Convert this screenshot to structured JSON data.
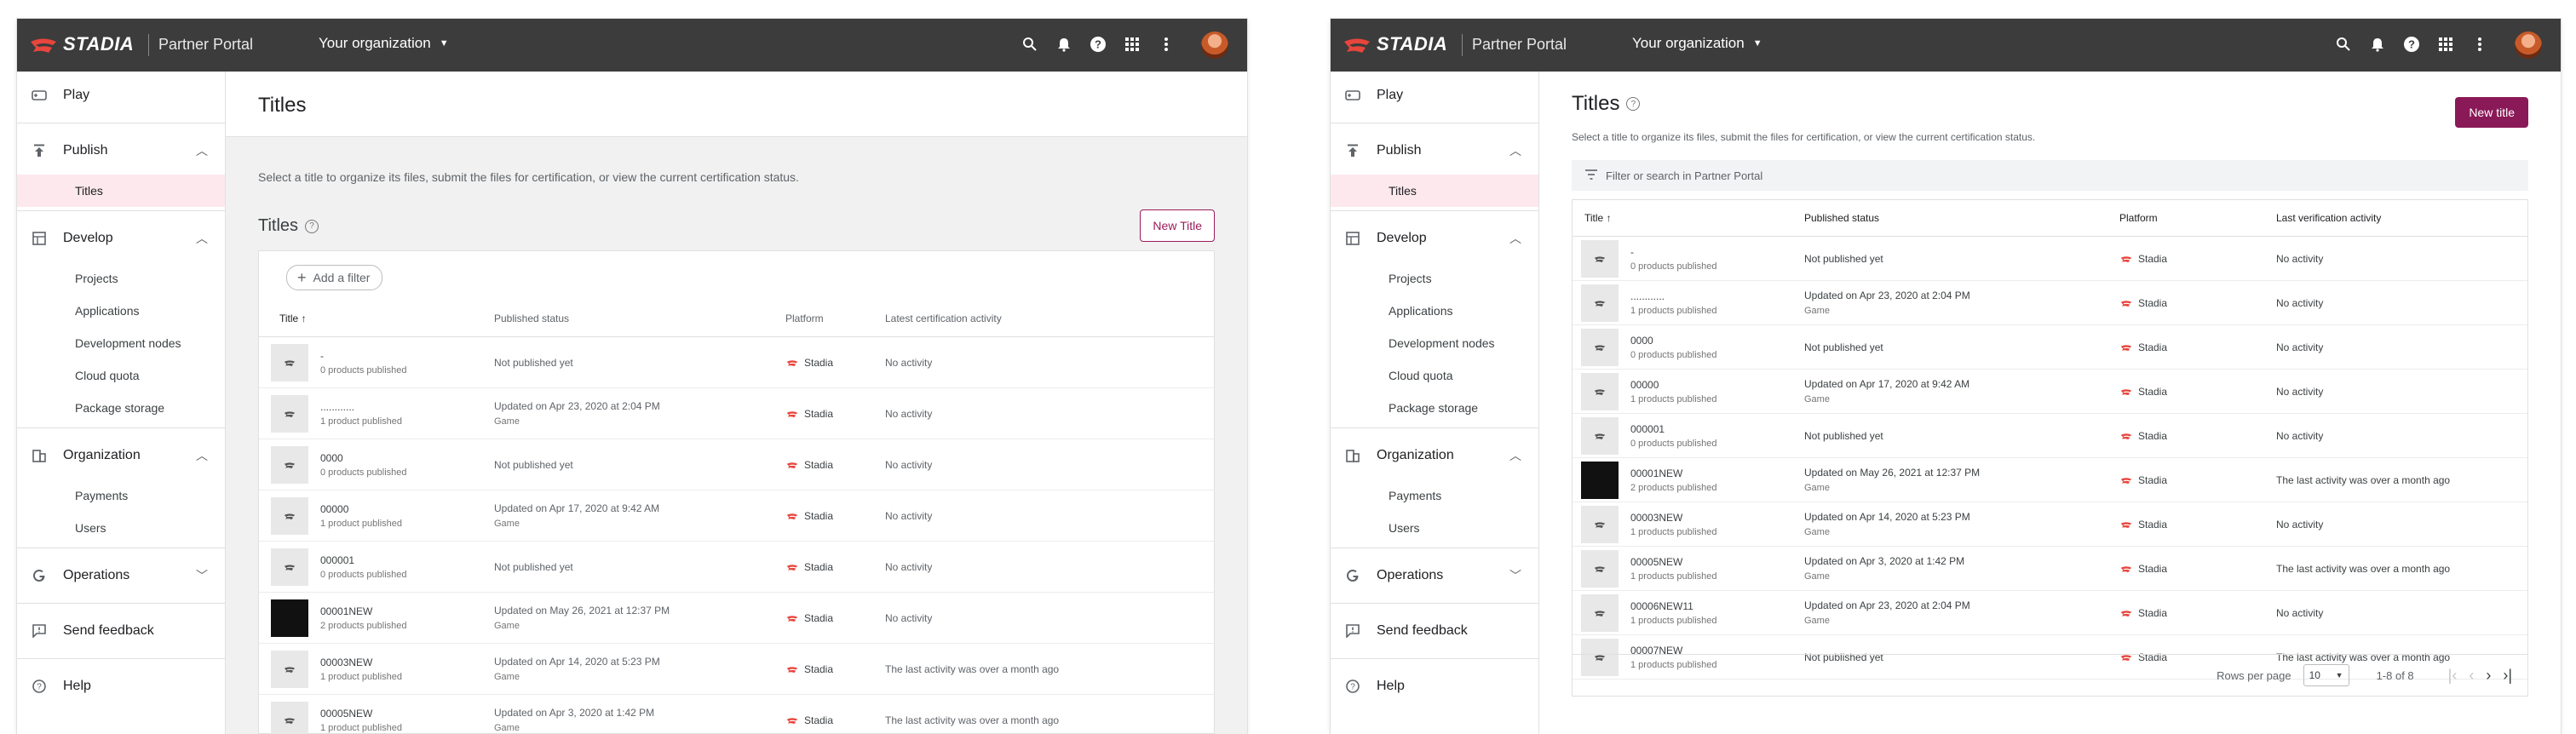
{
  "app": {
    "brand": "STADIA",
    "portal_name": "Partner Portal",
    "org_menu": "Your organization",
    "brand_color": "#e8453c",
    "accent": "#8a1958"
  },
  "sidebar": {
    "play": "Play",
    "publish": "Publish",
    "titles": "Titles",
    "develop": "Develop",
    "develop_items": [
      "Projects",
      "Applications",
      "Development nodes",
      "Cloud quota",
      "Package storage"
    ],
    "organization": "Organization",
    "org_items": [
      "Payments",
      "Users"
    ],
    "operations": "Operations",
    "send_feedback": "Send feedback",
    "help": "Help"
  },
  "left": {
    "page_title": "Titles",
    "description": "Select a title to organize its files, submit the files for certification, or view the current certification status.",
    "section_title": "Titles",
    "new_button": "New Title",
    "add_filter": "Add a filter",
    "columns": [
      "Title",
      "Published status",
      "Platform",
      "Latest certification activity"
    ],
    "rows": [
      {
        "name": "-",
        "sub": "0 products published",
        "status": "Not published yet",
        "status2": "",
        "platform": "Stadia",
        "activity": "No activity",
        "dark": false
      },
      {
        "name": "............",
        "sub": "1 product published",
        "status": "Updated on Apr 23, 2020 at 2:04 PM",
        "status2": "Game",
        "platform": "Stadia",
        "activity": "No activity",
        "dark": false
      },
      {
        "name": "0000",
        "sub": "0 products published",
        "status": "Not published yet",
        "status2": "",
        "platform": "Stadia",
        "activity": "No activity",
        "dark": false
      },
      {
        "name": "00000",
        "sub": "1 product published",
        "status": "Updated on Apr 17, 2020 at 9:42 AM",
        "status2": "Game",
        "platform": "Stadia",
        "activity": "No activity",
        "dark": false
      },
      {
        "name": "000001",
        "sub": "0 products published",
        "status": "Not published yet",
        "status2": "",
        "platform": "Stadia",
        "activity": "No activity",
        "dark": false
      },
      {
        "name": "00001NEW",
        "sub": "2 products published",
        "status": "Updated on May 26, 2021 at 12:37 PM",
        "status2": "Game",
        "platform": "Stadia",
        "activity": "No activity",
        "dark": true
      },
      {
        "name": "00003NEW",
        "sub": "1 product published",
        "status": "Updated on Apr 14, 2020 at 5:23 PM",
        "status2": "Game",
        "platform": "Stadia",
        "activity": "The last activity was over a month ago",
        "dark": false
      },
      {
        "name": "00005NEW",
        "sub": "1 product published",
        "status": "Updated on Apr 3, 2020 at 1:42 PM",
        "status2": "Game",
        "platform": "Stadia",
        "activity": "The last activity was over a month ago",
        "dark": false
      }
    ]
  },
  "right": {
    "page_title": "Titles",
    "description": "Select a title to organize its files, submit the files for certification, or view the current certification status.",
    "new_button": "New title",
    "search_placeholder": "Filter or search in Partner Portal",
    "columns": [
      "Title",
      "Published status",
      "Platform",
      "Last verification activity"
    ],
    "rows": [
      {
        "name": "-",
        "sub": "0 products published",
        "status": "Not published yet",
        "status2": "",
        "platform": "Stadia",
        "activity": "No activity",
        "dark": false
      },
      {
        "name": "............",
        "sub": "1 products published",
        "status": "Updated on Apr 23, 2020 at 2:04 PM",
        "status2": "Game",
        "platform": "Stadia",
        "activity": "No activity",
        "dark": false
      },
      {
        "name": "0000",
        "sub": "0 products published",
        "status": "Not published yet",
        "status2": "",
        "platform": "Stadia",
        "activity": "No activity",
        "dark": false
      },
      {
        "name": "00000",
        "sub": "1 products published",
        "status": "Updated on Apr 17, 2020 at 9:42 AM",
        "status2": "Game",
        "platform": "Stadia",
        "activity": "No activity",
        "dark": false
      },
      {
        "name": "000001",
        "sub": "0 products published",
        "status": "Not published yet",
        "status2": "",
        "platform": "Stadia",
        "activity": "No activity",
        "dark": false
      },
      {
        "name": "00001NEW",
        "sub": "2 products published",
        "status": "Updated on May 26, 2021 at 12:37 PM",
        "status2": "Game",
        "platform": "Stadia",
        "activity": "The last activity was over a month ago",
        "dark": true
      },
      {
        "name": "00003NEW",
        "sub": "1 products published",
        "status": "Updated on Apr 14, 2020 at 5:23 PM",
        "status2": "Game",
        "platform": "Stadia",
        "activity": "No activity",
        "dark": false
      },
      {
        "name": "00005NEW",
        "sub": "1 products published",
        "status": "Updated on Apr 3, 2020 at 1:42 PM",
        "status2": "Game",
        "platform": "Stadia",
        "activity": "The last activity was over a month ago",
        "dark": false
      },
      {
        "name": "00006NEW11",
        "sub": "1 products published",
        "status": "Updated on Apr 23, 2020 at 2:04 PM",
        "status2": "Game",
        "platform": "Stadia",
        "activity": "No activity",
        "dark": false
      },
      {
        "name": "00007NEW",
        "sub": "1 products published",
        "status": "Not published yet",
        "status2": "",
        "platform": "Stadia",
        "activity": "The last activity was over a month ago",
        "dark": false
      }
    ],
    "rows_per_page_label": "Rows per page",
    "rows_per_page": "10",
    "range": "1-8 of 8"
  }
}
